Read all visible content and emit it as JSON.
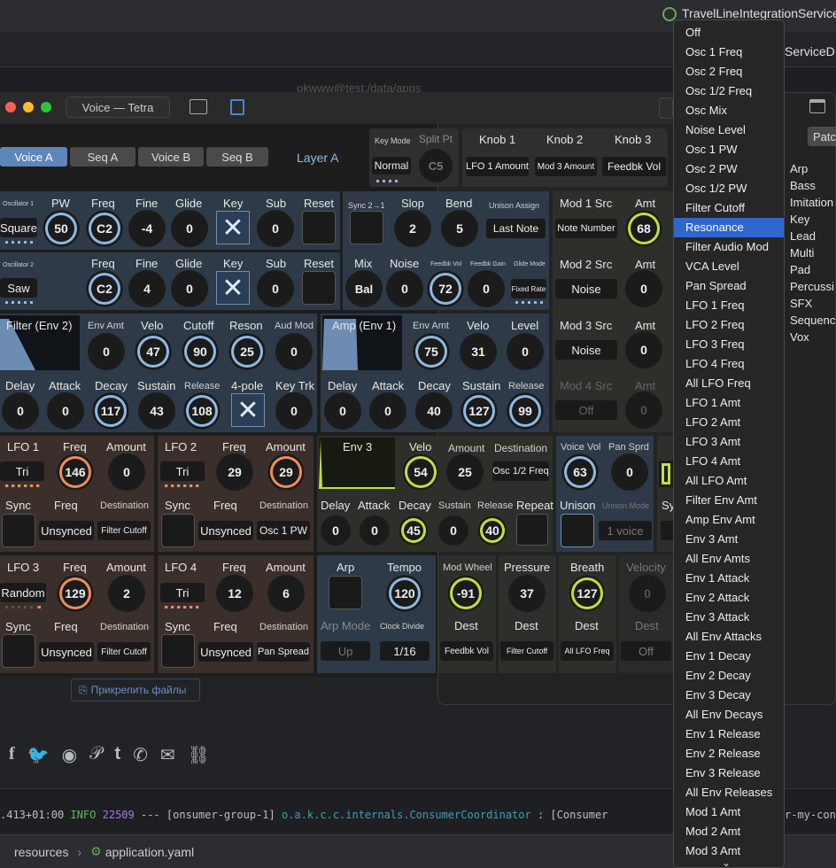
{
  "ide": {
    "run_config": "TravelLineIntegrationService",
    "run_config_short": "ServiceDI",
    "path_faded": "okwww@test:/data/apps",
    "attach_files": "Прикрепить файлы",
    "log_line": {
      "time": ".413+01:00",
      "level": "INFO",
      "pid": "22509",
      "sep": "---",
      "thread": "[onsumer-group-1]",
      "logger": "o.a.k.c.c.internals.ConsumerCoordinator",
      "msg": ": [Consumer",
      "msg2": "r-my-con"
    },
    "breadcrumb": {
      "folder": "resources",
      "file": "application.yaml"
    },
    "share_icons": [
      "facebook-icon",
      "twitter-icon",
      "reddit-icon",
      "pinterest-icon",
      "tumblr-icon",
      "whatsapp-icon",
      "mail-icon",
      "link-icon"
    ]
  },
  "window": {
    "title": "Voice — Tetra"
  },
  "tabs": [
    "Voice A",
    "Seq A",
    "Voice B",
    "Seq B"
  ],
  "layer": "Layer A",
  "keymode": {
    "label": "Key Mode",
    "value": "Normal",
    "split_label": "Split Pt",
    "split_value": "C5"
  },
  "knobs_top": {
    "labels": [
      "Knob 1",
      "Knob 2",
      "Knob 3"
    ],
    "values": [
      "LFO 1 Amount",
      "Mod 3 Amount",
      "Feedbk Vol"
    ]
  },
  "osc1": {
    "title": "Oscillator 1",
    "shape": "Square",
    "labels": [
      "PW",
      "Freq",
      "Fine",
      "Glide",
      "Key",
      "Sub",
      "Reset"
    ],
    "values": [
      "50",
      "C2",
      "-4",
      "0",
      "0"
    ]
  },
  "osc2": {
    "title": "Oscillator 2",
    "shape": "Saw",
    "labels": [
      "Freq",
      "Fine",
      "Glide",
      "Key",
      "Sub",
      "Reset"
    ],
    "values": [
      "C2",
      "4",
      "0",
      "0"
    ]
  },
  "mid": {
    "sync_label": "Sync 2→1",
    "slop_label": "Slop",
    "slop": "2",
    "bend_label": "Bend",
    "bend": "5",
    "unison_assign_label": "Unison Assign",
    "unison_assign": "Last Note",
    "mix_label": "Mix",
    "mix": "Bal",
    "noise_label": "Noise",
    "noise": "0",
    "feedbk_vol_label": "Feedbk Vol",
    "feedbk_vol": "72",
    "feedbk_gain_label": "Feedbk Gain",
    "feedbk_gain": "0",
    "glide_mode_label": "Glide Mode",
    "glide_mode": "Fixed Rate"
  },
  "mods": [
    {
      "src_label": "Mod 1 Src",
      "src": "Note Number",
      "amt_label": "Amt",
      "amt": "68"
    },
    {
      "src_label": "Mod 2 Src",
      "src": "Noise",
      "amt_label": "Amt",
      "amt": "0"
    },
    {
      "src_label": "Mod 3 Src",
      "src": "Noise",
      "amt_label": "Amt",
      "amt": "0"
    },
    {
      "src_label": "Mod 4 Src",
      "src": "Off",
      "amt_label": "Amt",
      "amt": "0"
    }
  ],
  "filter": {
    "title": "Filter (Env 2)",
    "labels": [
      "Env Amt",
      "Velo",
      "Cutoff",
      "Reson",
      "Aud Mod"
    ],
    "values": [
      "0",
      "47",
      "90",
      "25",
      "0"
    ],
    "labels2": [
      "Delay",
      "Attack",
      "Decay",
      "Sustain",
      "Release",
      "4-pole",
      "Key Trk"
    ],
    "values2": [
      "0",
      "0",
      "117",
      "43",
      "108",
      "0"
    ]
  },
  "amp": {
    "title": "Amp (Env 1)",
    "labels": [
      "Env Amt",
      "Velo",
      "Level"
    ],
    "values": [
      "75",
      "31",
      "0"
    ],
    "labels2": [
      "Delay",
      "Attack",
      "Decay",
      "Sustain",
      "Release"
    ],
    "values2": [
      "0",
      "0",
      "40",
      "127",
      "99"
    ]
  },
  "lfo1": {
    "title": "LFO 1",
    "shape": "Tri",
    "freq_label": "Freq",
    "freq": "146",
    "amount_label": "Amount",
    "amount": "0",
    "sync_label": "Sync",
    "freq2_label": "Freq",
    "freq2": "Unsynced",
    "dest_label": "Destination",
    "dest": "Filter Cutoff"
  },
  "lfo2": {
    "title": "LFO 2",
    "shape": "Tri",
    "freq_label": "Freq",
    "freq": "29",
    "amount_label": "Amount",
    "amount": "29",
    "sync_label": "Sync",
    "freq2_label": "Freq",
    "freq2": "Unsynced",
    "dest_label": "Destination",
    "dest": "Osc 1 PW"
  },
  "lfo3": {
    "title": "LFO 3",
    "shape": "Random",
    "freq_label": "Freq",
    "freq": "129",
    "amount_label": "Amount",
    "amount": "2",
    "sync_label": "Sync",
    "freq2_label": "Freq",
    "freq2": "Unsynced",
    "dest_label": "Destination",
    "dest": "Filter Cutoff"
  },
  "lfo4": {
    "title": "LFO 4",
    "shape": "Tri",
    "freq_label": "Freq",
    "freq": "12",
    "amount_label": "Amount",
    "amount": "6",
    "sync_label": "Sync",
    "freq2_label": "Freq",
    "freq2": "Unsynced",
    "dest_label": "Destination",
    "dest": "Pan Spread"
  },
  "env3": {
    "title": "Env 3",
    "velo_label": "Velo",
    "velo": "54",
    "amount_label": "Amount",
    "amount": "25",
    "dest_label": "Destination",
    "dest": "Osc 1/2 Freq",
    "labels2": [
      "Delay",
      "Attack",
      "Decay",
      "Sustain",
      "Release",
      "Repeat"
    ],
    "values2": [
      "0",
      "0",
      "45",
      "0",
      "40"
    ]
  },
  "voice": {
    "vol_label": "Voice Vol",
    "vol": "63",
    "pan_label": "Pan Sprd",
    "pan": "0",
    "unison_label": "Unison",
    "unison_mode_label": "Unison Mode",
    "unison_mode": "1 voice",
    "partial_label": "Sy"
  },
  "arp": {
    "arp_label": "Arp",
    "tempo_label": "Tempo",
    "tempo": "120",
    "mode_label": "Arp Mode",
    "mode": "Up",
    "clock_label": "Clock Divide",
    "clock": "1/16"
  },
  "ctrl": [
    {
      "label": "Mod Wheel",
      "value": "-91",
      "dest_label": "Dest",
      "dest": "Feedbk Vol"
    },
    {
      "label": "Pressure",
      "value": "37",
      "dest_label": "Dest",
      "dest": "Filter Cutoff"
    },
    {
      "label": "Breath",
      "value": "127",
      "dest_label": "Dest",
      "dest": "All LFO Freq"
    },
    {
      "label": "Velocity",
      "value": "0",
      "dest_label": "Dest",
      "dest": "Off"
    }
  ],
  "patch": {
    "button": "Patc",
    "categories": [
      "Arp",
      "Bass",
      "Imitation",
      "Key",
      "Lead",
      "Multi",
      "Pad",
      "Percussi",
      "SFX",
      "Sequenc",
      "Vox"
    ]
  },
  "menu": {
    "selected": "Resonance",
    "items": [
      "Off",
      "Osc 1 Freq",
      "Osc 2 Freq",
      "Osc 1/2 Freq",
      "Osc Mix",
      "Noise Level",
      "Osc 1 PW",
      "Osc 2 PW",
      "Osc 1/2 PW",
      "Filter Cutoff",
      "Resonance",
      "Filter Audio Mod",
      "VCA Level",
      "Pan Spread",
      "LFO 1 Freq",
      "LFO 2 Freq",
      "LFO 3 Freq",
      "LFO 4 Freq",
      "All LFO Freq",
      "LFO 1 Amt",
      "LFO 2 Amt",
      "LFO 3 Amt",
      "LFO 4 Amt",
      "All LFO Amt",
      "Filter Env Amt",
      "Amp Env Amt",
      "Env 3 Amt",
      "All Env Amts",
      "Env 1 Attack",
      "Env 2 Attack",
      "Env 3 Attack",
      "All Env Attacks",
      "Env 1 Decay",
      "Env 2 Decay",
      "Env 3 Decay",
      "All Env Decays",
      "Env 1 Release",
      "Env 2 Release",
      "Env 3 Release",
      "All Env Releases",
      "Mod 1 Amt",
      "Mod 2 Amt",
      "Mod 3 Amt"
    ]
  },
  "colors": {
    "accent_blue": "#8fb9e6",
    "accent_orange": "#f08c5c",
    "accent_green": "#c2e038",
    "menu_select": "#2f66d0"
  }
}
